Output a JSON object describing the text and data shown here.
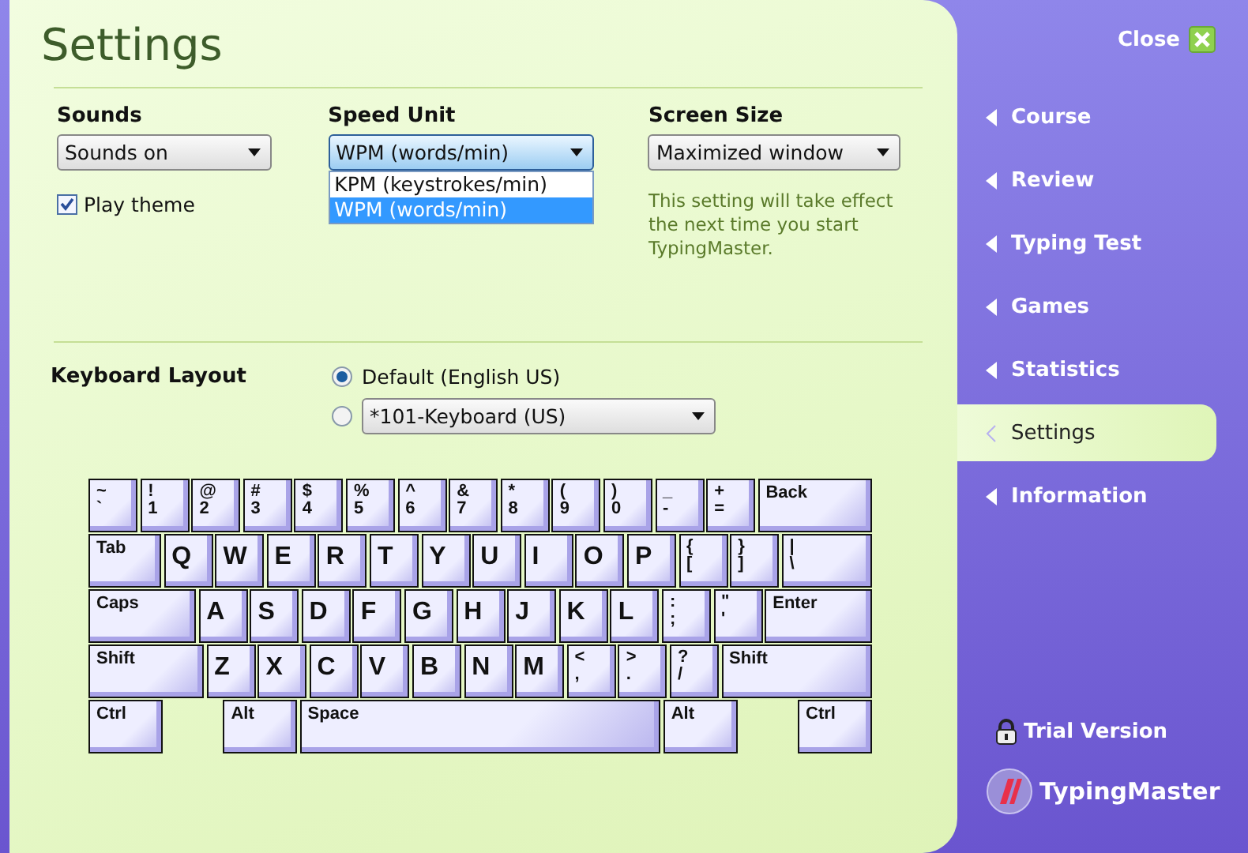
{
  "title": "Settings",
  "sounds": {
    "label": "Sounds",
    "value": "Sounds on"
  },
  "play_theme": {
    "label": "Play theme",
    "checked": true
  },
  "speed_unit": {
    "label": "Speed Unit",
    "value": "WPM (words/min)",
    "expanded": true,
    "options": [
      {
        "label": "KPM (keystrokes/min)",
        "selected": false
      },
      {
        "label": "WPM (words/min)",
        "selected": true
      }
    ]
  },
  "screen_size": {
    "label": "Screen Size",
    "value": "Maximized window",
    "note": "This setting will take effect the next time you start TypingMaster."
  },
  "keyboard_layout": {
    "label": "Keyboard Layout",
    "options": [
      {
        "kind": "radio",
        "label": "Default (English US)",
        "selected": true
      },
      {
        "kind": "dropdown",
        "value": "*101-Keyboard (US)",
        "selected": false
      }
    ]
  },
  "keyboard": [
    [
      {
        "kind": "key",
        "upper": "~",
        "lower": "`"
      },
      {
        "kind": "key",
        "upper": "!",
        "lower": "1"
      },
      {
        "kind": "key",
        "upper": "@",
        "lower": "2"
      },
      {
        "kind": "key",
        "upper": "#",
        "lower": "3"
      },
      {
        "kind": "key",
        "upper": "$",
        "lower": "4"
      },
      {
        "kind": "key",
        "upper": "%",
        "lower": "5"
      },
      {
        "kind": "key",
        "upper": "^",
        "lower": "6"
      },
      {
        "kind": "key",
        "upper": "&",
        "lower": "7"
      },
      {
        "kind": "key",
        "upper": "*",
        "lower": "8"
      },
      {
        "kind": "key",
        "upper": "(",
        "lower": "9"
      },
      {
        "kind": "key",
        "upper": ")",
        "lower": "0"
      },
      {
        "kind": "key",
        "upper": "_",
        "lower": "-"
      },
      {
        "kind": "key",
        "upper": "+",
        "lower": "="
      },
      {
        "kind": "fill",
        "label": "Back"
      }
    ],
    [
      {
        "kind": "tab",
        "label": "Tab"
      },
      {
        "kind": "key",
        "label": "Q"
      },
      {
        "kind": "key",
        "label": "W"
      },
      {
        "kind": "key",
        "label": "E"
      },
      {
        "kind": "key",
        "label": "R"
      },
      {
        "kind": "key",
        "label": "T"
      },
      {
        "kind": "key",
        "label": "Y"
      },
      {
        "kind": "key",
        "label": "U"
      },
      {
        "kind": "key",
        "label": "I"
      },
      {
        "kind": "key",
        "label": "O"
      },
      {
        "kind": "key",
        "label": "P"
      },
      {
        "kind": "key",
        "upper": "{",
        "lower": "["
      },
      {
        "kind": "key",
        "upper": "}",
        "lower": "]"
      },
      {
        "kind": "fill",
        "upper": "|",
        "lower": "\\"
      }
    ],
    [
      {
        "kind": "caps",
        "label": "Caps"
      },
      {
        "kind": "key",
        "label": "A"
      },
      {
        "kind": "key",
        "label": "S"
      },
      {
        "kind": "key",
        "label": "D"
      },
      {
        "kind": "key",
        "label": "F"
      },
      {
        "kind": "key",
        "label": "G"
      },
      {
        "kind": "key",
        "label": "H"
      },
      {
        "kind": "key",
        "label": "J"
      },
      {
        "kind": "key",
        "label": "K"
      },
      {
        "kind": "key",
        "label": "L"
      },
      {
        "kind": "key",
        "upper": ":",
        "lower": ";"
      },
      {
        "kind": "key",
        "upper": "\"",
        "lower": "'"
      },
      {
        "kind": "fill",
        "label": "Enter"
      }
    ],
    [
      {
        "kind": "shift",
        "label": "Shift"
      },
      {
        "kind": "key",
        "label": "Z"
      },
      {
        "kind": "key",
        "label": "X"
      },
      {
        "kind": "key",
        "label": "C"
      },
      {
        "kind": "key",
        "label": "V"
      },
      {
        "kind": "key",
        "label": "B"
      },
      {
        "kind": "key",
        "label": "N"
      },
      {
        "kind": "key",
        "label": "M"
      },
      {
        "kind": "key",
        "upper": "<",
        "lower": ","
      },
      {
        "kind": "key",
        "upper": ">",
        "lower": "."
      },
      {
        "kind": "key",
        "upper": "?",
        "lower": "/"
      },
      {
        "kind": "fill",
        "label": "Shift"
      }
    ],
    [
      {
        "kind": "ctrl",
        "label": "Ctrl"
      },
      {
        "kind": "gap"
      },
      {
        "kind": "ctrl",
        "label": "Alt"
      },
      {
        "kind": "fill",
        "label": "Space"
      },
      {
        "kind": "ctrl",
        "label": "Alt"
      },
      {
        "kind": "gap"
      },
      {
        "kind": "ctrl",
        "label": "Ctrl"
      }
    ]
  ],
  "close": {
    "label": "Close"
  },
  "nav": [
    {
      "label": "Course",
      "selected": false
    },
    {
      "label": "Review",
      "selected": false
    },
    {
      "label": "Typing Test",
      "selected": false
    },
    {
      "label": "Games",
      "selected": false
    },
    {
      "label": "Statistics",
      "selected": false
    },
    {
      "label": "Settings",
      "selected": true
    },
    {
      "label": "Information",
      "selected": false
    }
  ],
  "trial": "Trial Version",
  "logo": "TypingMaster"
}
